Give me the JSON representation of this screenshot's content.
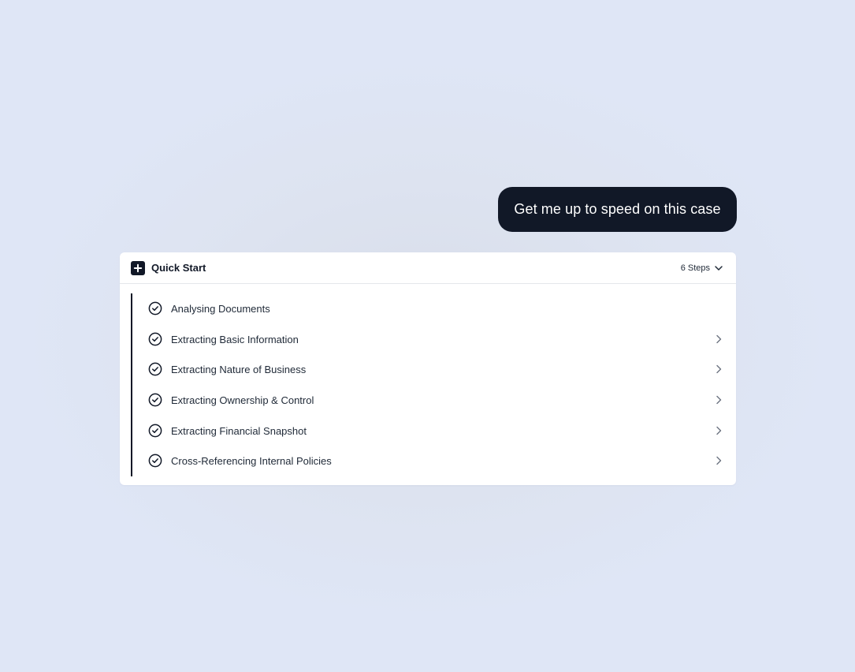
{
  "chat": {
    "message": "Get me up to speed on this case"
  },
  "quick_start": {
    "title": "Quick Start",
    "steps_count_label": "6 Steps",
    "steps": [
      {
        "label": "Analysing Documents",
        "status": "complete",
        "expandable": false
      },
      {
        "label": "Extracting Basic Information",
        "status": "complete",
        "expandable": true
      },
      {
        "label": "Extracting Nature of Business",
        "status": "complete",
        "expandable": true
      },
      {
        "label": "Extracting Ownership & Control",
        "status": "complete",
        "expandable": true
      },
      {
        "label": "Extracting Financial Snapshot",
        "status": "complete",
        "expandable": true
      },
      {
        "label": "Cross-Referencing Internal Policies",
        "status": "complete",
        "expandable": true
      }
    ],
    "icons": {
      "header": "plus-square-icon",
      "toggle": "chevron-down-icon",
      "step_status": "check-circle-icon",
      "step_expand": "chevron-right-icon"
    }
  },
  "colors": {
    "accent_dark": "#111827",
    "panel_background": "#ffffff",
    "page_background": "#dfe6f6"
  }
}
